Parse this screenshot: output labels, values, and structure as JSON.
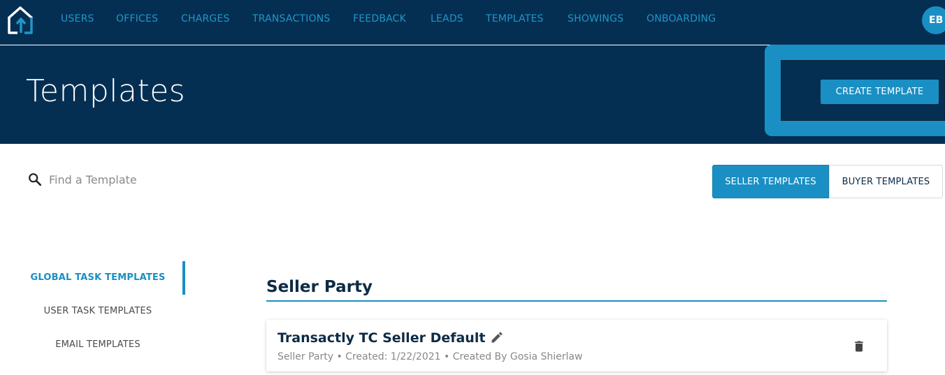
{
  "nav": {
    "items": [
      {
        "label": "USERS"
      },
      {
        "label": "OFFICES"
      },
      {
        "label": "CHARGES"
      },
      {
        "label": "TRANSACTIONS"
      },
      {
        "label": "FEEDBACK"
      },
      {
        "label": "LEADS"
      },
      {
        "label": "TEMPLATES"
      },
      {
        "label": "SHOWINGS"
      },
      {
        "label": "ONBOARDING"
      }
    ],
    "avatar_initials": "EB"
  },
  "header": {
    "title": "Templates",
    "create_button": "CREATE TEMPLATE"
  },
  "search": {
    "placeholder": "Find a Template",
    "value": ""
  },
  "template_type_toggle": {
    "seller": "SELLER TEMPLATES",
    "buyer": "BUYER TEMPLATES",
    "selected": "SELLER TEMPLATES"
  },
  "sidebar": {
    "items": [
      {
        "label": "GLOBAL TASK TEMPLATES",
        "active": true
      },
      {
        "label": "USER TASK TEMPLATES",
        "active": false
      },
      {
        "label": "EMAIL TEMPLATES",
        "active": false
      }
    ]
  },
  "section": {
    "title": "Seller Party",
    "templates": [
      {
        "name": "Transactly TC Seller Default",
        "meta": "Seller Party • Created: 1/22/2021 • Created By Gosia Shierlaw"
      }
    ]
  },
  "colors": {
    "navy": "#042f52",
    "accent": "#1a8fc3",
    "title_text": "#0d2b45",
    "muted_text": "#888888"
  },
  "icons": [
    "house-logo-icon",
    "search-icon",
    "pencil-edit-icon",
    "trash-delete-icon"
  ]
}
